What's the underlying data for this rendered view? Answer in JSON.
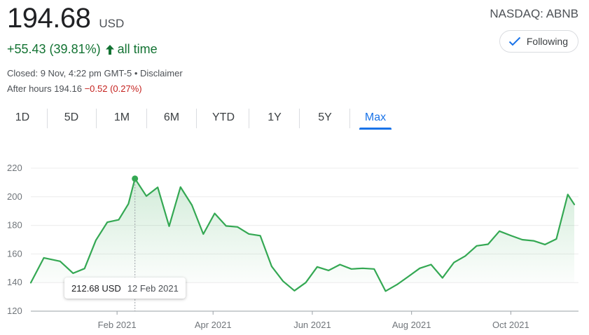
{
  "quote": {
    "price": "194.68",
    "currency": "USD",
    "change": "+55.43 (39.81%)",
    "change_period": "all time",
    "exchange": "NASDAQ: ABNB",
    "follow_label": "Following",
    "closed_text": "Closed: 9 Nov, 4:22 pm GMT-5 • Disclaimer",
    "after_hours_label": "After hours 194.16",
    "after_hours_change": "−0.52 (0.27%)"
  },
  "tabs": [
    "1D",
    "5D",
    "1M",
    "6M",
    "YTD",
    "1Y",
    "5Y",
    "Max"
  ],
  "active_tab": "Max",
  "colors": {
    "line": "#34a853",
    "positive": "#137333",
    "negative": "#c5221f",
    "accent": "#1a73e8"
  },
  "tooltip": {
    "price": "212.68 USD",
    "date": "12 Feb 2021"
  },
  "chart_data": {
    "type": "line",
    "title": "",
    "xlabel": "",
    "ylabel": "",
    "ylim": [
      120,
      220
    ],
    "yticks": [
      120,
      140,
      160,
      180,
      200,
      220
    ],
    "xticks": [
      "Feb 2021",
      "Apr 2021",
      "Jun 2021",
      "Aug 2021",
      "Oct 2021"
    ],
    "xrange": [
      "2020-12-10",
      "2021-11-09"
    ],
    "grid": true,
    "x": [
      "2020-12-10",
      "2020-12-18",
      "2020-12-28",
      "2021-01-05",
      "2021-01-12",
      "2021-01-19",
      "2021-01-26",
      "2021-02-02",
      "2021-02-08",
      "2021-02-12",
      "2021-02-19",
      "2021-02-26",
      "2021-03-05",
      "2021-03-12",
      "2021-03-19",
      "2021-03-26",
      "2021-04-02",
      "2021-04-09",
      "2021-04-16",
      "2021-04-23",
      "2021-04-30",
      "2021-05-07",
      "2021-05-14",
      "2021-05-21",
      "2021-05-28",
      "2021-06-04",
      "2021-06-11",
      "2021-06-18",
      "2021-06-25",
      "2021-07-02",
      "2021-07-09",
      "2021-07-16",
      "2021-07-23",
      "2021-07-30",
      "2021-08-06",
      "2021-08-13",
      "2021-08-20",
      "2021-08-27",
      "2021-09-03",
      "2021-09-10",
      "2021-09-17",
      "2021-09-24",
      "2021-10-01",
      "2021-10-08",
      "2021-10-15",
      "2021-10-22",
      "2021-10-29",
      "2021-11-05",
      "2021-11-09"
    ],
    "series": [
      {
        "values": [
          139.9,
          157.3,
          154.9,
          146.5,
          149.8,
          169.6,
          182.2,
          183.9,
          195.1,
          212.68,
          200.5,
          206.6,
          179.4,
          206.8,
          194.2,
          173.9,
          188.4,
          179.6,
          178.9,
          174.0,
          172.8,
          151.3,
          141.0,
          134.3,
          140.0,
          151.0,
          148.5,
          152.6,
          149.5,
          150.0,
          149.5,
          134.0,
          138.6,
          144.2,
          150.0,
          152.6,
          143.3,
          154.0,
          158.6,
          165.7,
          166.8,
          176.0,
          172.9,
          170.0,
          169.2,
          166.6,
          170.5,
          201.6,
          194.68
        ]
      }
    ]
  }
}
